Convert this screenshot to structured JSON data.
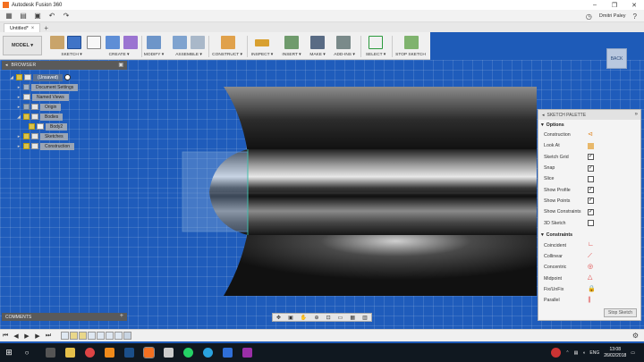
{
  "window": {
    "title": "Autodesk Fusion 360",
    "controls": [
      "–",
      "❐",
      "✕"
    ]
  },
  "quick_access": {
    "user": "Dmitri Paley"
  },
  "tabs": [
    {
      "label": "Untitled*"
    }
  ],
  "toolbar": {
    "workspace": "MODEL ▾",
    "groups": [
      {
        "label": "SKETCH ▾"
      },
      {
        "label": "CREATE ▾"
      },
      {
        "label": "MODIFY ▾"
      },
      {
        "label": "ASSEMBLE ▾"
      },
      {
        "label": "CONSTRUCT ▾"
      },
      {
        "label": "INSPECT ▾"
      },
      {
        "label": "INSERT ▾"
      },
      {
        "label": "MAKE ▾"
      },
      {
        "label": "ADD-INS ▾"
      },
      {
        "label": "SELECT ▾"
      },
      {
        "label": "STOP SKETCH"
      }
    ]
  },
  "browser": {
    "title": "BROWSER",
    "items": [
      {
        "label": "(Unsaved)"
      },
      {
        "label": "Document Settings"
      },
      {
        "label": "Named Views"
      },
      {
        "label": "Origin"
      },
      {
        "label": "Bodies"
      },
      {
        "label": "Body2"
      },
      {
        "label": "Sketches"
      },
      {
        "label": "Construction"
      }
    ]
  },
  "comments": {
    "title": "COMMENTS"
  },
  "viewcube": {
    "label": "BACK"
  },
  "palette": {
    "title": "SKETCH PALETTE",
    "options_title": "Options",
    "options": [
      {
        "label": "Construction"
      },
      {
        "label": "Look At"
      },
      {
        "label": "Sketch Grid"
      },
      {
        "label": "Snap"
      },
      {
        "label": "Slice"
      },
      {
        "label": "Show Profile"
      },
      {
        "label": "Show Points"
      },
      {
        "label": "Show Constraints"
      },
      {
        "label": "3D Sketch"
      }
    ],
    "constraints_title": "Constraints",
    "constraints": [
      {
        "label": "Coincident"
      },
      {
        "label": "Collinear"
      },
      {
        "label": "Concentric"
      },
      {
        "label": "Midpoint"
      },
      {
        "label": "Fix/UnFix"
      },
      {
        "label": "Parallel"
      }
    ],
    "stop_label": "Stop Sketch"
  },
  "taskbar": {
    "lang": "ENG",
    "time": "13:08",
    "date": "26/02/2018"
  },
  "colors": {
    "viewport": "#1f5cbb",
    "accent": "#f37021"
  }
}
